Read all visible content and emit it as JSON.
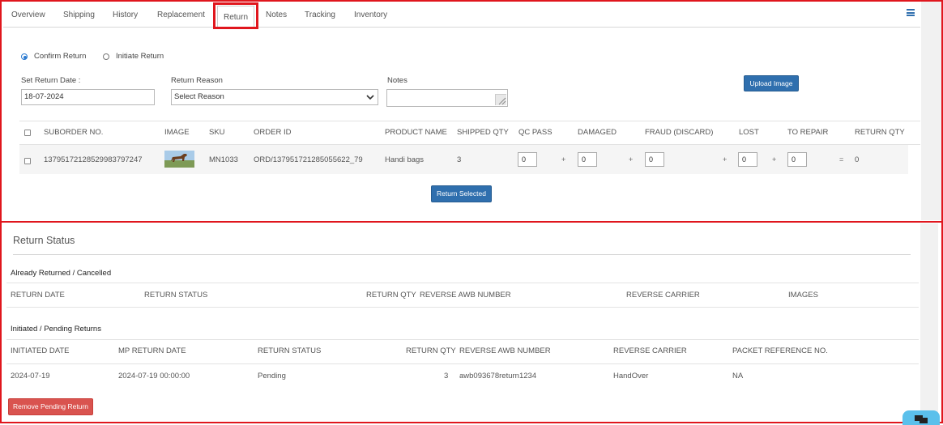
{
  "tabs": [
    "Overview",
    "Shipping",
    "History",
    "Replacement",
    "Return",
    "Notes",
    "Tracking",
    "Inventory"
  ],
  "active_tab": "Return",
  "return_form": {
    "confirm_label": "Confirm Return",
    "initiate_label": "Initiate Return",
    "date_label": "Set Return Date :",
    "date_value": "18-07-2024",
    "reason_label": "Return Reason",
    "reason_value": "Select Reason",
    "notes_label": "Notes",
    "upload_label": "Upload Image"
  },
  "items_table": {
    "headers": [
      "SUBORDER NO.",
      "IMAGE",
      "SKU",
      "ORDER ID",
      "PRODUCT NAME",
      "SHIPPED QTY",
      "QC PASS",
      "DAMAGED",
      "FRAUD (DISCARD)",
      "LOST",
      "TO REPAIR",
      "RETURN QTY"
    ],
    "row": {
      "suborder": "1379517212852998379724 7",
      "sku": "MN1033",
      "order_id": "ORD/137951721285055622_79",
      "product": "Handi bags",
      "shipped_qty": "3",
      "qc_pass": "0",
      "damaged": "0",
      "fraud": "0",
      "lost": "0",
      "to_repair": "0",
      "return_qty": "0"
    },
    "ops": {
      "plus": "+",
      "equals": "="
    },
    "return_selected_label": "Return Selected"
  },
  "status": {
    "title": "Return Status",
    "returned_title": "Already Returned / Cancelled",
    "returned_headers": [
      "RETURN DATE",
      "RETURN STATUS",
      "RETURN QTY",
      "REVERSE AWB NUMBER",
      "REVERSE CARRIER",
      "IMAGES"
    ],
    "pending_title": "Initiated / Pending Returns",
    "pending_headers": [
      "INITIATED DATE",
      "MP RETURN DATE",
      "RETURN STATUS",
      "RETURN QTY",
      "REVERSE AWB NUMBER",
      "REVERSE CARRIER",
      "PACKET REFERENCE NO."
    ],
    "pending_row": [
      "2024-07-19",
      "2024-07-19 00:00:00",
      "Pending",
      "3",
      "awb093678return1234",
      "HandOver",
      "NA"
    ],
    "remove_label": "Remove Pending Return"
  },
  "colors": {
    "accent": "#2f6fae",
    "danger": "#d9534f",
    "highlight": "#e0161d"
  }
}
